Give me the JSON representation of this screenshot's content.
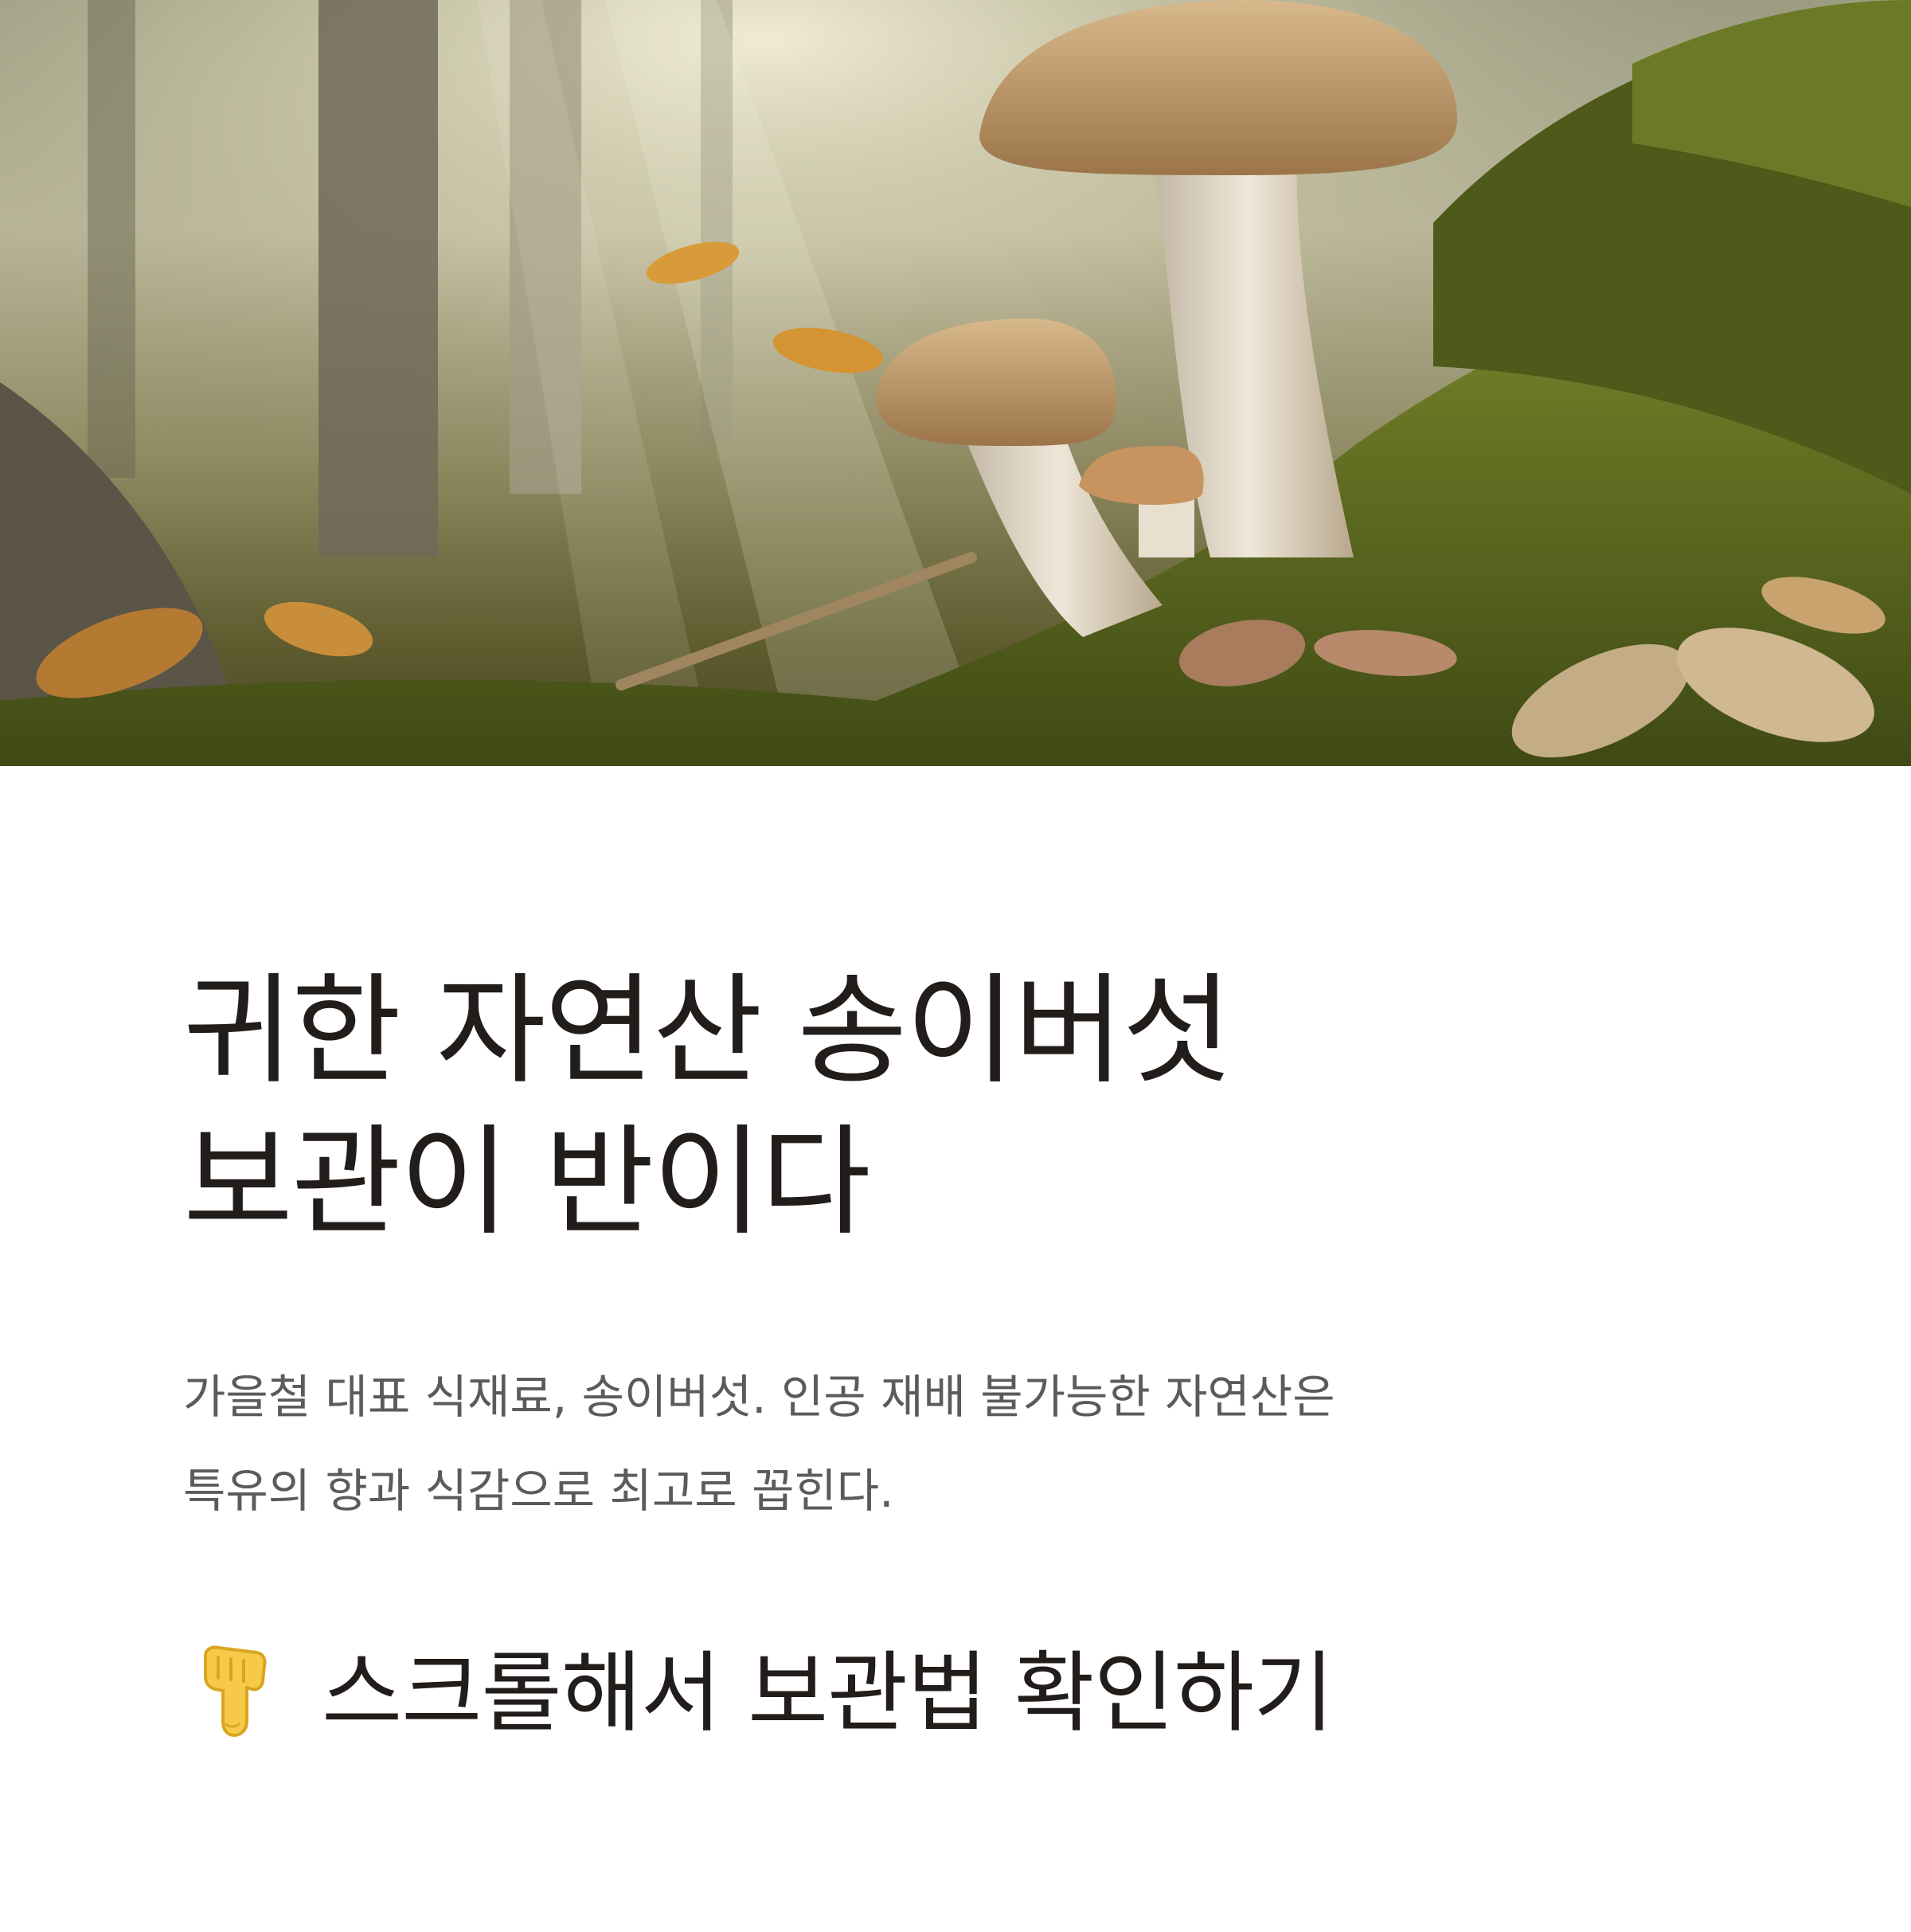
{
  "hero": {
    "image": "forest-mushroom-photo"
  },
  "headline": {
    "line1": "귀한 자연산 송이버섯",
    "line2": "보관이 반이다"
  },
  "description": {
    "line1": "가을철 대표 식재료, 송이버섯. 인공 재배 불가능한 자연산은",
    "line2": "특유의 향과 식감으로 최고로 꼽힌다."
  },
  "cta": {
    "icon": "pointing-down-hand-icon",
    "label": "스크롤해서 보관법 확인하기"
  },
  "colors": {
    "heading": "#221d1a",
    "body": "#5b5b5b",
    "background": "#ffffff"
  }
}
